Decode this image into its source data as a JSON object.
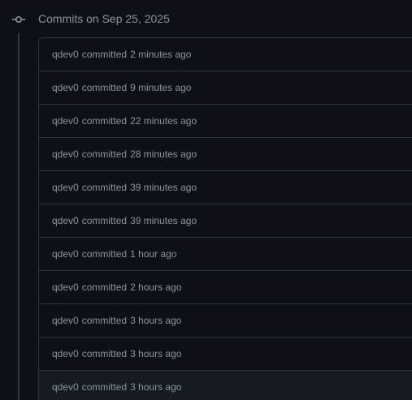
{
  "group": {
    "title": "Commits on Sep 25, 2025"
  },
  "colors": {
    "background": "#0d1117",
    "border": "#30363d",
    "muted_text": "#8b949e",
    "hover_row": "#161b22"
  },
  "commits": [
    {
      "author": "qdev0",
      "verb": "committed",
      "time": "2 minutes ago"
    },
    {
      "author": "qdev0",
      "verb": "committed",
      "time": "9 minutes ago"
    },
    {
      "author": "qdev0",
      "verb": "committed",
      "time": "22 minutes ago"
    },
    {
      "author": "qdev0",
      "verb": "committed",
      "time": "28 minutes ago"
    },
    {
      "author": "qdev0",
      "verb": "committed",
      "time": "39 minutes ago"
    },
    {
      "author": "qdev0",
      "verb": "committed",
      "time": "39 minutes ago"
    },
    {
      "author": "qdev0",
      "verb": "committed",
      "time": "1 hour ago"
    },
    {
      "author": "qdev0",
      "verb": "committed",
      "time": "2 hours ago"
    },
    {
      "author": "qdev0",
      "verb": "committed",
      "time": "3 hours ago"
    },
    {
      "author": "qdev0",
      "verb": "committed",
      "time": "3 hours ago"
    },
    {
      "author": "qdev0",
      "verb": "committed",
      "time": "3 hours ago"
    }
  ]
}
